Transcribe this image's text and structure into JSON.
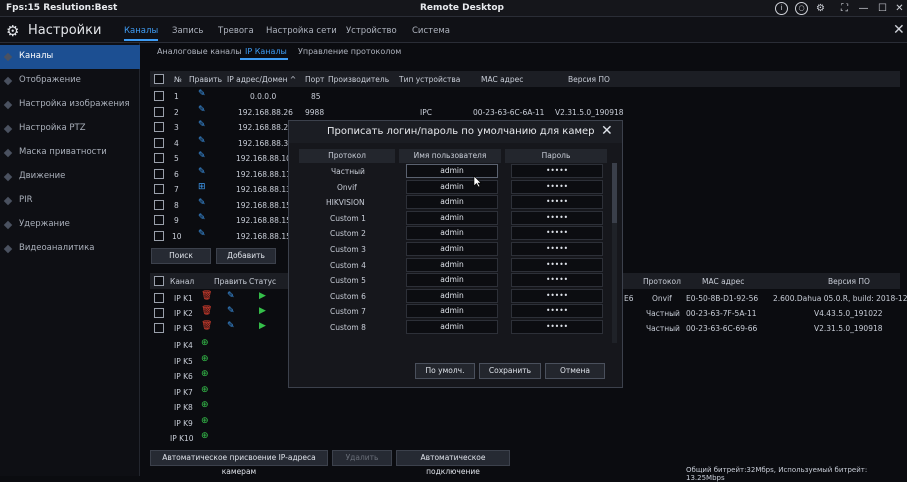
{
  "titlebar": {
    "left": "Fps:15 Reslution:Best",
    "center": "Remote Desktop"
  },
  "header": {
    "title": "Настройки",
    "tabs": [
      "Каналы",
      "Запись",
      "Тревога",
      "Настройка сети",
      "Устройство",
      "Система"
    ]
  },
  "sidebar": {
    "items": [
      "Каналы",
      "Отображение",
      "Настройка изображения",
      "Настройка PTZ",
      "Маска приватности",
      "Движение",
      "PIR",
      "Удержание",
      "Видеоаналитика"
    ]
  },
  "subtabs": [
    "Аналоговые каналы",
    "IP Каналы",
    "Управление протоколом"
  ],
  "table1": {
    "headers": [
      "№",
      "Править",
      "IP адрес/Домен ^",
      "Порт",
      "Производитель",
      "Тип устройства",
      "MAC адрес",
      "Версия ПО"
    ],
    "rows": [
      [
        "1",
        "0.0.0.0",
        "85",
        "",
        "",
        ""
      ],
      [
        "2",
        "192.168.88.26",
        "9988",
        "IPC",
        "00-23-63-6C-6A-11",
        "V2.31.5.0_190918"
      ],
      [
        "3",
        "192.168.88.29",
        "",
        "",
        "",
        ""
      ],
      [
        "4",
        "192.168.88.30",
        "",
        "",
        "",
        ""
      ],
      [
        "5",
        "192.168.88.100",
        "",
        "",
        "",
        ""
      ],
      [
        "6",
        "192.168.88.111",
        "",
        "",
        "",
        ""
      ],
      [
        "7",
        "192.168.88.134",
        "",
        "",
        "",
        ""
      ],
      [
        "8",
        "192.168.88.151",
        "",
        "",
        "",
        ""
      ],
      [
        "9",
        "192.168.88.152",
        "",
        "",
        "",
        ""
      ],
      [
        "10",
        "192.168.88.153",
        "",
        "",
        "",
        ""
      ]
    ]
  },
  "buttons1": [
    "Поиск",
    "Добавить"
  ],
  "table2": {
    "headers": [
      "Канал",
      "Править",
      "Статус"
    ],
    "right_headers": [
      "Протокол",
      "MAC адрес",
      "Версия ПО"
    ],
    "rows": [
      {
        "ch": "IP K1",
        "proto": "Onvif",
        "mac": "E0-50-8B-D1-92-56",
        "ver": "2.600.Dahua 05.0.R, build: 2018-12-",
        "ext": "E6"
      },
      {
        "ch": "IP K2",
        "proto": "Частный",
        "mac": "00-23-63-7F-5A-11",
        "ver": "V4.43.5.0_191022",
        "ext": ""
      },
      {
        "ch": "IP K3",
        "proto": "Частный",
        "mac": "00-23-63-6C-69-66",
        "ver": "V2.31.5.0_190918",
        "ext": ""
      }
    ],
    "empty": [
      "IP K4",
      "IP K5",
      "IP K6",
      "IP K7",
      "IP K8",
      "IP K9",
      "IP K10"
    ]
  },
  "bottom_buttons": [
    "Автоматическое присвоение IP-адреса камерам",
    "Удалить",
    "Автоматическое подключение"
  ],
  "status": "Общий битрейт:32Мбps, Используемый битрейт: 13.25Мbps",
  "modal": {
    "title": "Прописать логин/пароль по умолчанию для камер",
    "cols": [
      "Протокол",
      "Имя пользователя",
      "Пароль"
    ],
    "rows": [
      [
        "Частный",
        "admin",
        "•••••"
      ],
      [
        "Onvif",
        "admin",
        "•••••"
      ],
      [
        "HIKVISION",
        "admin",
        "•••••"
      ],
      [
        "Custom 1",
        "admin",
        "•••••"
      ],
      [
        "Custom 2",
        "admin",
        "•••••"
      ],
      [
        "Custom 3",
        "admin",
        "•••••"
      ],
      [
        "Custom 4",
        "admin",
        "•••••"
      ],
      [
        "Custom 5",
        "admin",
        "•••••"
      ],
      [
        "Custom 6",
        "admin",
        "•••••"
      ],
      [
        "Custom 7",
        "admin",
        "•••••"
      ],
      [
        "Custom 8",
        "admin",
        "•••••"
      ]
    ],
    "buttons": [
      "По умолч.",
      "Сохранить",
      "Отмена"
    ]
  }
}
